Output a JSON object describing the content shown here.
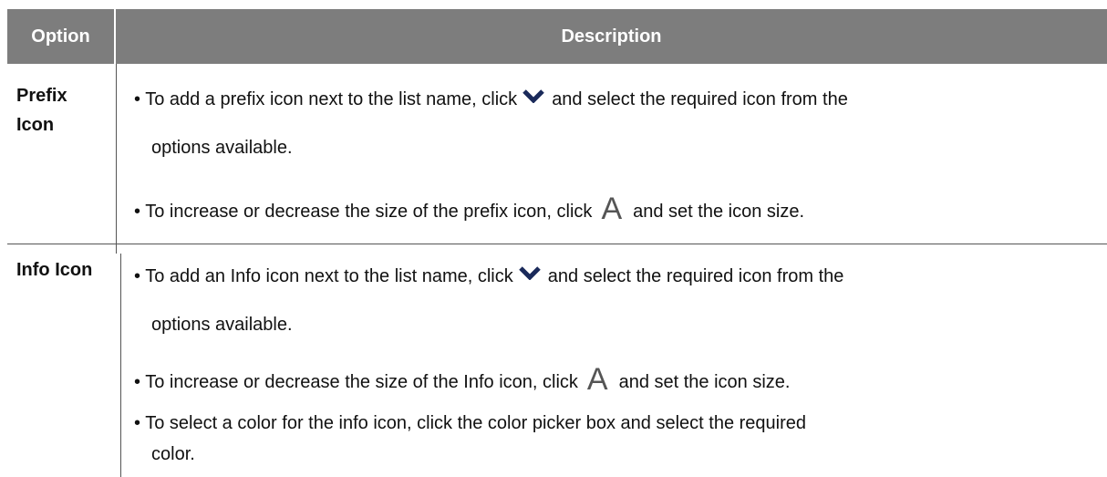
{
  "table": {
    "headers": {
      "option": "Option",
      "description": "Description"
    },
    "rows": [
      {
        "option": "Prefix Icon",
        "option_lines": [
          "Prefix",
          "Icon"
        ],
        "items": [
          {
            "before": "• To add a prefix icon next to the list name, click",
            "icon": "chevron-down-icon",
            "after": "and select the required icon from the",
            "continuation": "options available."
          },
          {
            "before": "• To increase or decrease the size of the prefix icon, click",
            "icon": "font-size-icon",
            "icon_glyph": "A",
            "after": "and set the icon size."
          }
        ]
      },
      {
        "option": "Info Icon",
        "items": [
          {
            "before": "• To add an Info icon next to the list name, click",
            "icon": "chevron-down-icon",
            "after": "and select the required icon from the",
            "continuation": "options available."
          },
          {
            "before": "• To increase or decrease the size of the Info icon, click",
            "icon": "font-size-icon",
            "icon_glyph": "A",
            "after": "and set the icon size."
          },
          {
            "text": "• To select a color for the info icon, click the color picker box and select the required",
            "continuation": "color."
          }
        ]
      }
    ]
  },
  "colors": {
    "header_bg": "#7d7d7d",
    "header_text": "#ffffff",
    "border": "#555555"
  }
}
